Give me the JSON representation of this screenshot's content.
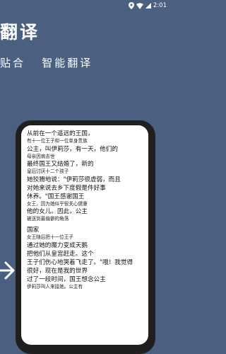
{
  "status_bar": {
    "time": "2:01"
  },
  "header": {
    "title": "翻译",
    "subtitle": "贴合   智能翻译"
  },
  "phone": {
    "lines": [
      {
        "text": "从前在一个遥远的王国，",
        "kind": "main"
      },
      {
        "text": "有十一位王子和一位单身贵族",
        "kind": "trans"
      },
      {
        "text": "公主，叫伊莉莎，有一天，他们的",
        "kind": "main"
      },
      {
        "text": "母亲因病去世",
        "kind": "trans"
      },
      {
        "text": "最终国王又结婚了，新的",
        "kind": "main"
      },
      {
        "text": "皇后讨厌十二个孩子",
        "kind": "trans"
      },
      {
        "text": "她狡猾地说：\"伊莉莎很虚弱，而且",
        "kind": "main"
      },
      {
        "text": "对她来说去乡下度假是件好事",
        "kind": "main"
      },
      {
        "text": "休养。\"国王感谢国王",
        "kind": "main"
      },
      {
        "text": "女王，因为她似乎很关心健康",
        "kind": "trans"
      },
      {
        "text": "他的女儿。因此，公主",
        "kind": "main"
      },
      {
        "text": "被送到最偏僻的角落",
        "kind": "trans"
      },
      {
        "text": "国家",
        "kind": "main",
        "gap": true
      },
      {
        "text": "女王随后把十一位王子",
        "kind": "trans"
      },
      {
        "text": "通过她的魔力变成天鹅",
        "kind": "main"
      },
      {
        "text": "把他们从皇宫赶走。这个",
        "kind": "main"
      },
      {
        "text": "王子们伤心地哭着飞走了。\"哦！我觉得",
        "kind": "main"
      },
      {
        "text": "很好，现在是我的世界",
        "kind": "main"
      },
      {
        "text": "过了一段时间，国王想念公主",
        "kind": "main"
      },
      {
        "text": "伊莉莎叫人来接她。公主有",
        "kind": "trans"
      }
    ]
  }
}
